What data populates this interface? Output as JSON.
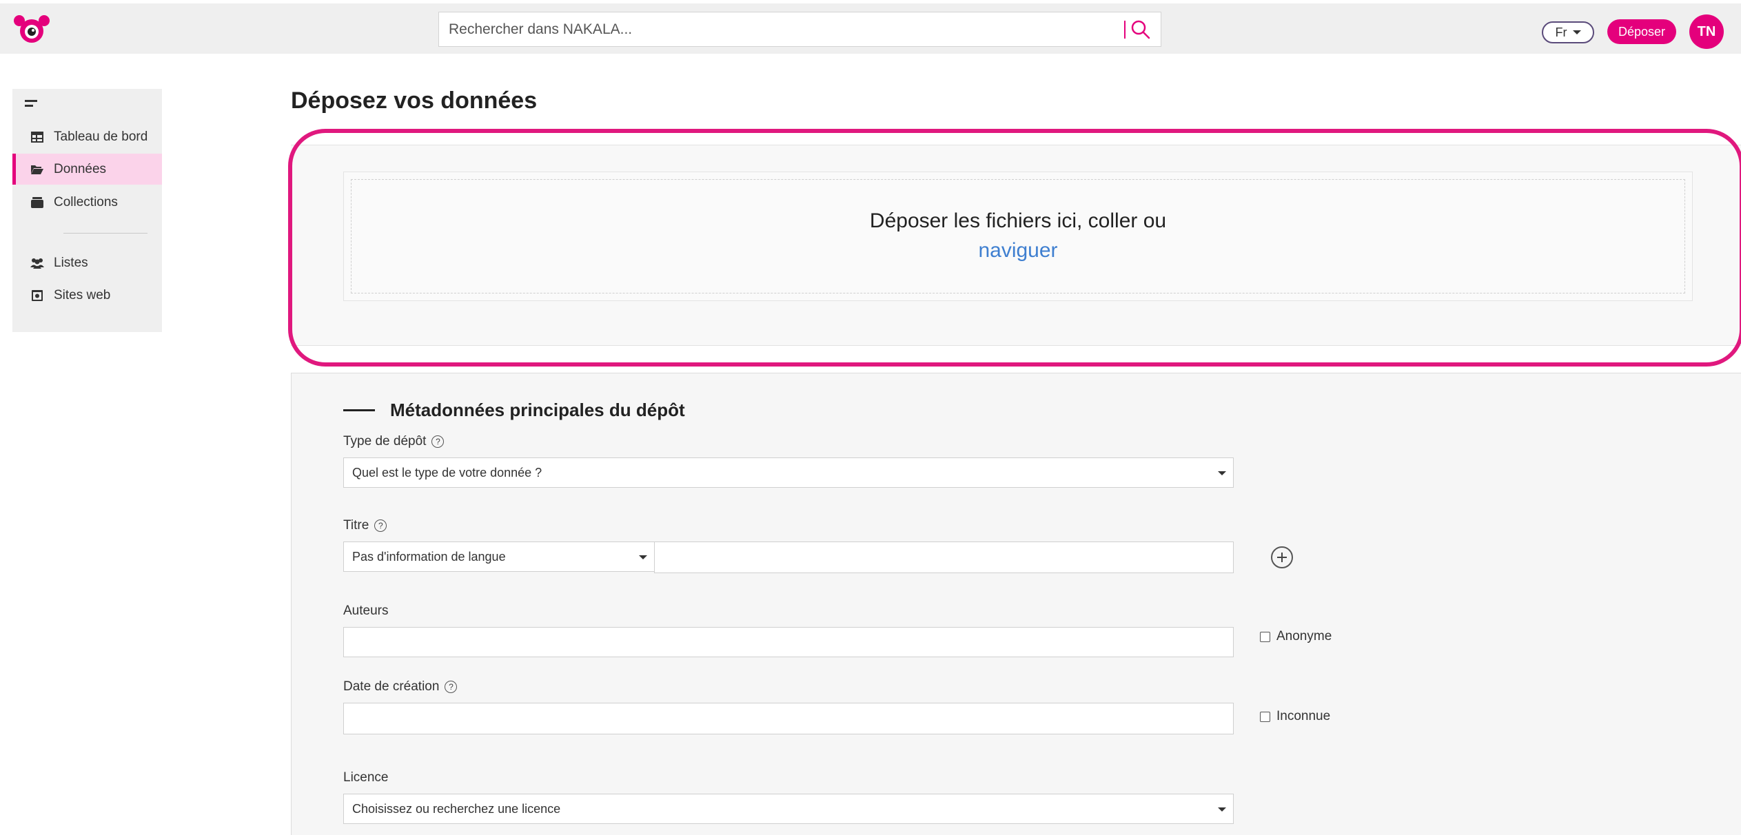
{
  "topbar": {
    "search_placeholder": "Rechercher dans NAKALA...",
    "lang": "Fr",
    "deposit_button": "Déposer",
    "avatar_initials": "TN",
    "accent_color": "#e4007c"
  },
  "sidebar": {
    "items": [
      {
        "label": "Tableau de bord",
        "icon": "dashboard-icon"
      },
      {
        "label": "Données",
        "icon": "folder-open-icon",
        "active": true
      },
      {
        "label": "Collections",
        "icon": "archive-icon"
      },
      {
        "label": "Listes",
        "icon": "users-icon"
      },
      {
        "label": "Sites web",
        "icon": "website-icon"
      }
    ]
  },
  "main": {
    "title": "Déposez vos données",
    "dropzone": {
      "text": "Déposer les fichiers ici, coller ou",
      "link": "naviguer"
    },
    "metadata": {
      "section_title": "Métadonnées principales du dépôt",
      "type": {
        "label": "Type de dépôt",
        "placeholder": "Quel est le type de votre donnée ?"
      },
      "title_field": {
        "label": "Titre",
        "language": "Pas d'information de langue",
        "value": ""
      },
      "authors": {
        "label": "Auteurs",
        "value": "",
        "anonymous_label": "Anonyme"
      },
      "creation_date": {
        "label": "Date de création",
        "value": "",
        "unknown_label": "Inconnue"
      },
      "license": {
        "label": "Licence",
        "placeholder": "Choisissez ou recherchez une licence"
      }
    }
  }
}
